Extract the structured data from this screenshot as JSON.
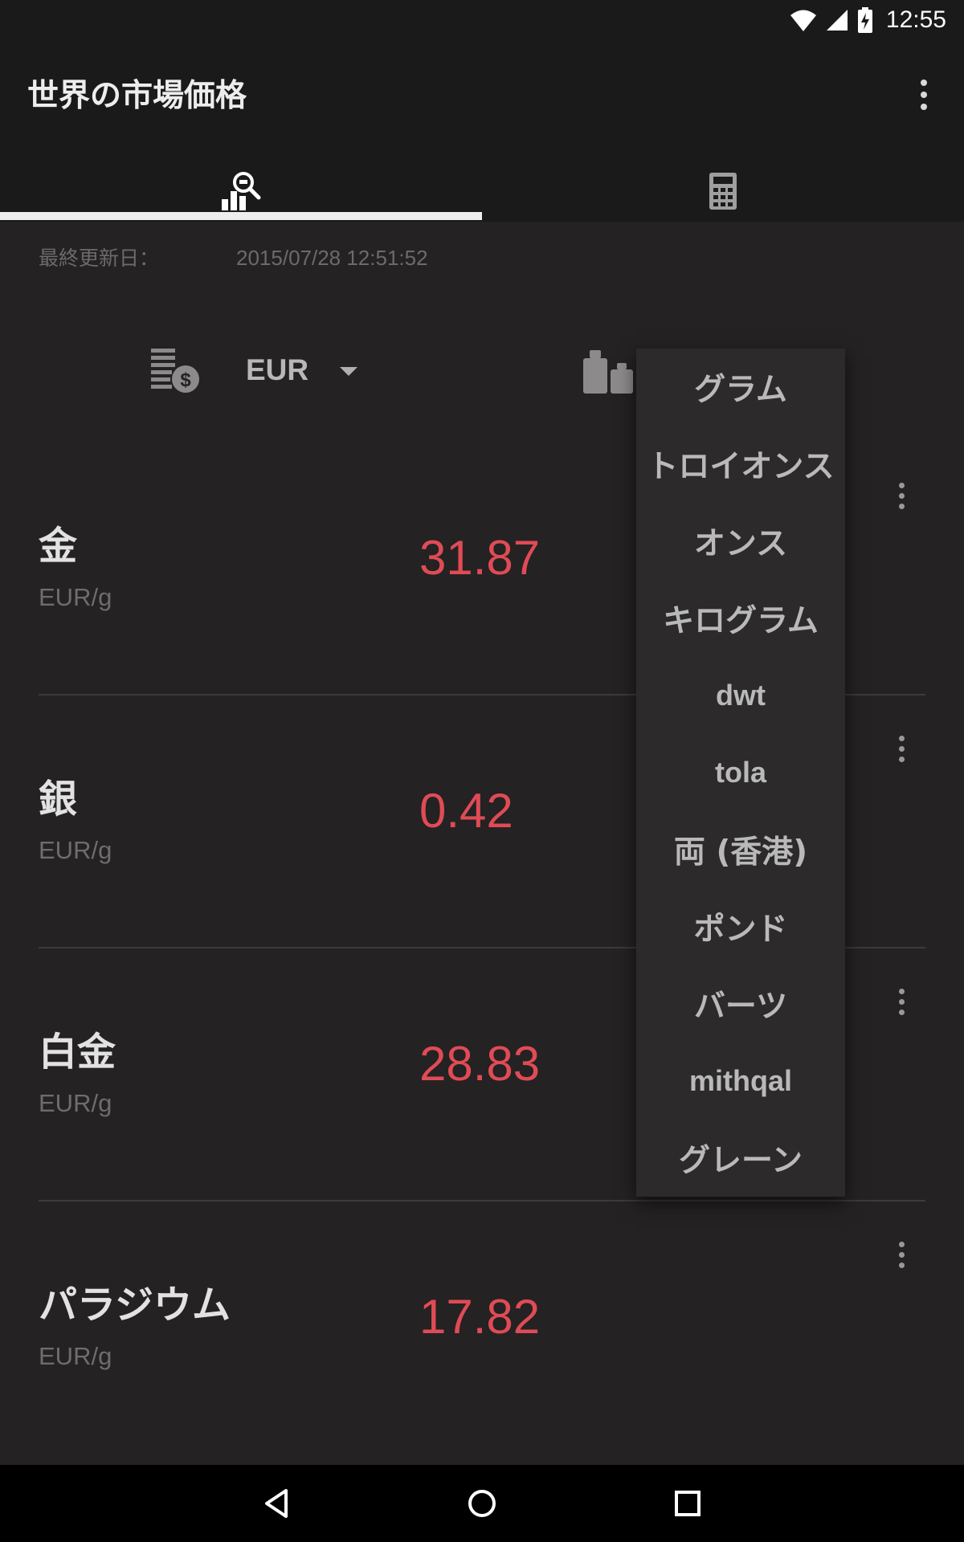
{
  "status_bar": {
    "time": "12:55"
  },
  "app_bar": {
    "title": "世界の市場価格"
  },
  "tabs": [
    {
      "name": "market",
      "icon": "chart-search-icon",
      "selected": true
    },
    {
      "name": "calculator",
      "icon": "calculator-icon",
      "selected": false
    }
  ],
  "last_updated": {
    "label": "最終更新日：",
    "value": "2015/07/28 12:51:52"
  },
  "currency": {
    "icon": "coins-dollar-icon",
    "value": "EUR"
  },
  "weight": {
    "icon": "weights-icon"
  },
  "metals": [
    {
      "name": "金",
      "unit": "EUR/g",
      "price": "31.87"
    },
    {
      "name": "銀",
      "unit": "EUR/g",
      "price": "0.42"
    },
    {
      "name": "白金",
      "unit": "EUR/g",
      "price": "28.83"
    },
    {
      "name": "パラジウム",
      "unit": "EUR/g",
      "price": "17.82"
    }
  ],
  "weight_units_menu": [
    "グラム",
    "トロイオンス",
    "オンス",
    "キログラム",
    "dwt",
    "tola",
    "両 (香港)",
    "ポンド",
    "バーツ",
    "mithqal",
    "グレーン"
  ],
  "colors": {
    "price": "#e04b55",
    "background": "#242223",
    "bar": "#1b1a1a"
  }
}
